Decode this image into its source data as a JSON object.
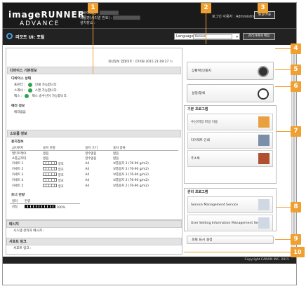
{
  "header": {
    "logo_line1": "imageRUNNER",
    "logo_line2": "ADVANCE",
    "device_labels": [
      "디바이스명 :",
      "제품명(시리얼 번호) :",
      "설치장소 :"
    ],
    "device_values": [
      "(blurred)",
      "(blurred)",
      ""
    ],
    "login_user": "로그인 사용자 : Administrator",
    "logout": "로그아웃",
    "remote_ui": "리모트 UI: 포털",
    "language_label": "Language:",
    "language_value": "Korean",
    "mail_btn": "관리자에게 메일"
  },
  "updated": "최신정보 업데이트 : 07/08 2015 21:09:27",
  "device_basic": {
    "title": "디바이스 기본정보",
    "state_title": "디바이스 상태",
    "states": [
      {
        "label": "프린터 :",
        "text": "인쇄 가능합니다."
      },
      {
        "label": "스캐너 :",
        "text": "스캔 가능합니다."
      },
      {
        "label": "팩스 :",
        "text": "팩스 송수신이 가능합니다."
      }
    ],
    "error_title": "에러 정보",
    "error_text": "에러없음"
  },
  "consumables": {
    "title": "소모품 정보",
    "paper_title": "용지정보",
    "headers": [
      "급지위치",
      "용지 잔량",
      "용지 크기",
      "용지 종류"
    ],
    "rows": [
      [
        "멀티트레이",
        "없음",
        "알수없음",
        "없음"
      ],
      [
        "소통급지대",
        "없음",
        "알수없음",
        "없음"
      ],
      [
        "카세트 1",
        "양호",
        "A4",
        "보통용지 2 (76-90 g/m2)"
      ],
      [
        "카세트 2",
        "양호",
        "A4",
        "보통용지 2 (76-90 g/m2)"
      ],
      [
        "카세트 3",
        "양호",
        "A4",
        "보통용지 2 (76-90 g/m2)"
      ],
      [
        "카세트 4",
        "양호",
        "A4",
        "보통용지 2 (76-90 g/m2)"
      ],
      [
        "카세트 5",
        "양호",
        "A4",
        "보통용지 2 (76-90 g/m2)"
      ]
    ],
    "toner_title": "토너 잔량",
    "toner_headers": [
      "컬러",
      "잔량"
    ],
    "toner_color": "검정",
    "toner_pct": "100%"
  },
  "messages": {
    "title": "메시지",
    "sub": "시스템 관리자 메시지 :",
    "support_title": "서포트 링크",
    "support_text": "서포트 링크 :"
  },
  "right": {
    "status": "상황확인/중지",
    "settings": "설정/등록",
    "basic_title": "기본 프로그램",
    "basic_items": [
      "수신/저장 파일 이용",
      "다이렉트 인쇄",
      "주소록"
    ],
    "mgmt_title": "관리 프로그램",
    "mgmt_items": [
      "Service Management Service",
      "User Setting Information Management Service"
    ],
    "portal": "포털 표시 설정"
  },
  "footer": "Copyright CANON INC. 2015",
  "callouts": [
    "1",
    "2",
    "3",
    "4",
    "5",
    "6",
    "7",
    "8",
    "9",
    "10"
  ],
  "colors": {
    "accent": "#f0a030",
    "header": "#1a1a1a"
  }
}
